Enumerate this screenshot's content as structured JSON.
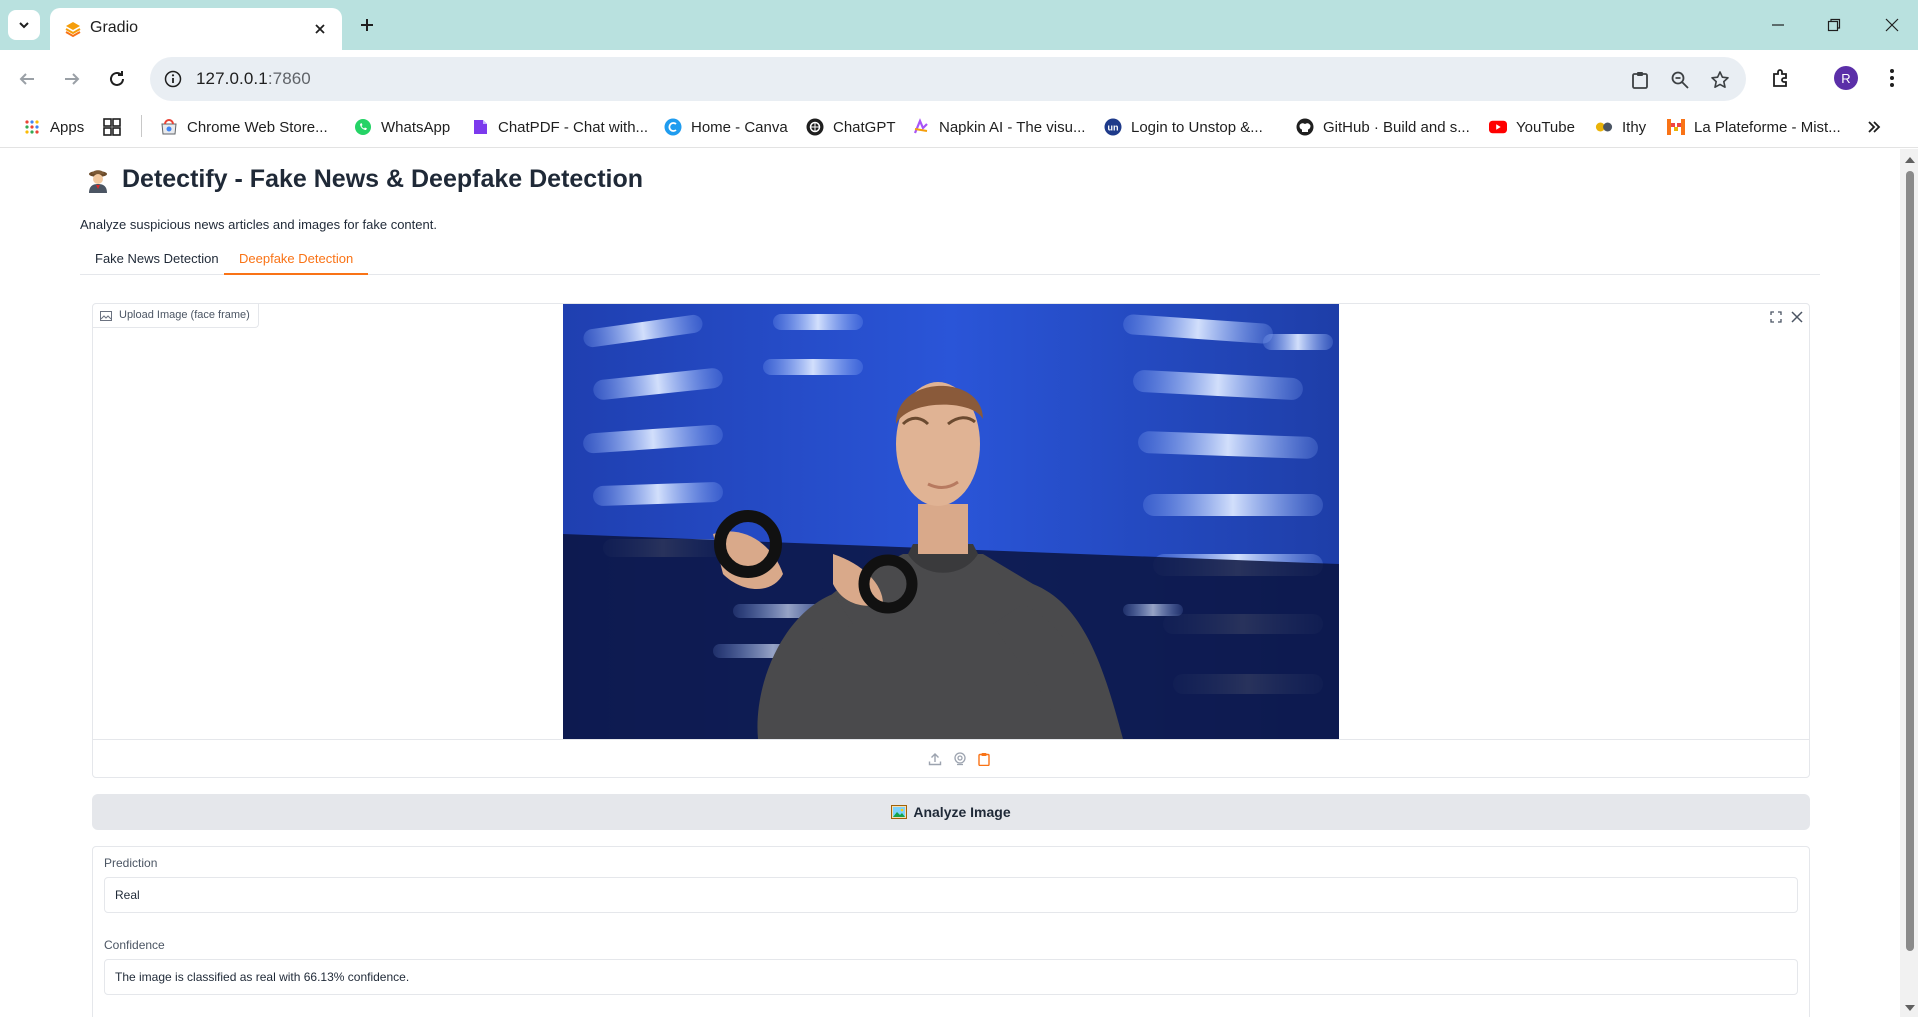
{
  "browser": {
    "tab_title": "Gradio",
    "url_host": "127.0.0.1",
    "url_port": ":7860",
    "profile_initial": "R",
    "bookmarks": [
      {
        "label": "Apps",
        "icon": "apps-grid-icon"
      },
      {
        "label": "",
        "icon": "tab-groups-icon"
      },
      {
        "label": "Chrome Web Store...",
        "icon": "chrome-web-store-icon"
      },
      {
        "label": "WhatsApp",
        "icon": "whatsapp-icon"
      },
      {
        "label": "ChatPDF - Chat with...",
        "icon": "chatpdf-icon"
      },
      {
        "label": "Home - Canva",
        "icon": "canva-icon"
      },
      {
        "label": "ChatGPT",
        "icon": "chatgpt-icon"
      },
      {
        "label": "Napkin AI - The visu...",
        "icon": "napkin-icon"
      },
      {
        "label": "Login to Unstop &...",
        "icon": "unstop-icon"
      },
      {
        "label": "GitHub · Build and s...",
        "icon": "github-icon"
      },
      {
        "label": "YouTube",
        "icon": "youtube-icon"
      },
      {
        "label": "Ithy",
        "icon": "ithy-icon"
      },
      {
        "label": "La Plateforme - Mist...",
        "icon": "mistral-icon"
      }
    ]
  },
  "app": {
    "title": "Detectify - Fake News & Deepfake Detection",
    "description": "Analyze suspicious news articles and images for fake content.",
    "tabs": [
      {
        "label": "Fake News Detection",
        "active": false
      },
      {
        "label": "Deepfake Detection",
        "active": true
      }
    ],
    "image_input": {
      "label": "Upload Image (face frame)",
      "image_subject": "person in grey t-shirt holding VR controllers on stage"
    },
    "analyze_button": "Analyze Image",
    "outputs": {
      "prediction_label": "Prediction",
      "prediction_value": "Real",
      "confidence_label": "Confidence",
      "confidence_value": "The image is classified as real with 66.13% confidence."
    }
  },
  "colors": {
    "tabstrip": "#b9e1df",
    "accent": "#f97316",
    "button_bg": "#e5e7eb"
  }
}
